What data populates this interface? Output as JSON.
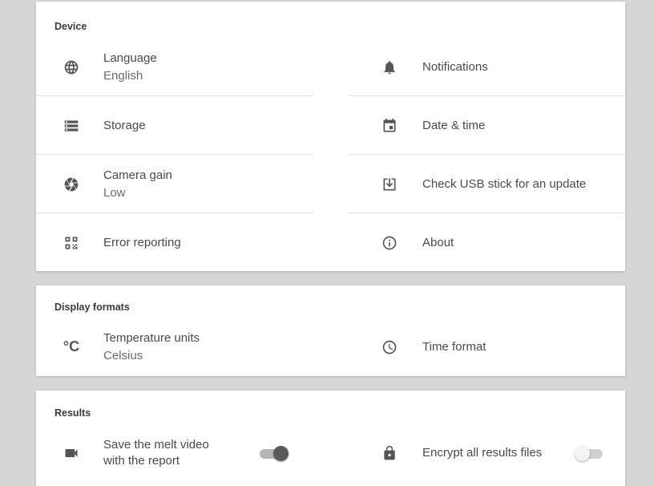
{
  "device": {
    "title": "Device",
    "left": [
      {
        "label": "Language",
        "value": "English",
        "icon": "globe-icon"
      },
      {
        "label": "Storage",
        "value": "",
        "icon": "storage-icon"
      },
      {
        "label": "Camera gain",
        "value": "Low",
        "icon": "camera-aperture-icon"
      },
      {
        "label": "Error reporting",
        "value": "",
        "icon": "qr-code-icon"
      }
    ],
    "right": [
      {
        "label": "Notifications",
        "icon": "bell-icon"
      },
      {
        "label": "Date & time",
        "icon": "calendar-icon"
      },
      {
        "label": "Check USB stick for an update",
        "icon": "download-box-icon"
      },
      {
        "label": "About",
        "icon": "info-icon"
      }
    ]
  },
  "display_formats": {
    "title": "Display formats",
    "temperature": {
      "label": "Temperature units",
      "value": "Celsius",
      "icon_text": "°C"
    },
    "time_format": {
      "label": "Time format"
    }
  },
  "results": {
    "title": "Results",
    "melt_video": {
      "label_line1": "Save the melt video",
      "label_line2": "with the report",
      "enabled": true
    },
    "encrypt": {
      "label": "Encrypt all results files",
      "enabled": false
    }
  }
}
